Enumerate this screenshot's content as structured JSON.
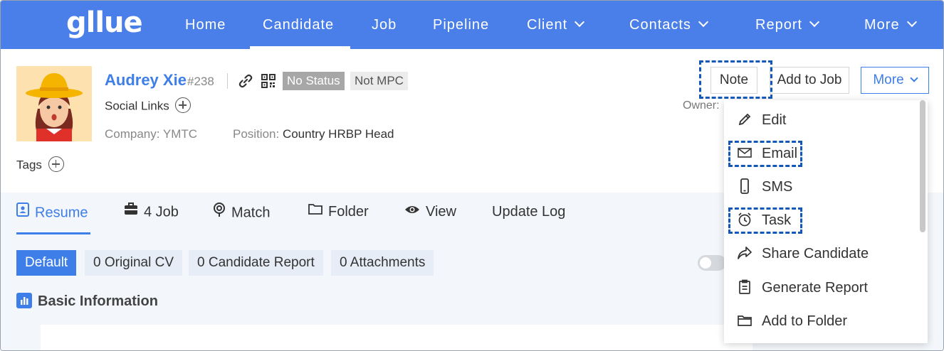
{
  "app": {
    "logo": "gllue"
  },
  "nav": {
    "items": [
      {
        "label": "Home"
      },
      {
        "label": "Candidate"
      },
      {
        "label": "Job"
      },
      {
        "label": "Pipeline"
      },
      {
        "label": "Client"
      },
      {
        "label": "Contacts"
      },
      {
        "label": "Report"
      },
      {
        "label": "More"
      }
    ],
    "active": "Candidate"
  },
  "candidate": {
    "name": "Audrey Xie",
    "id": "#238",
    "status_badge": "No Status",
    "mpc_badge": "Not MPC",
    "social_links_label": "Social Links",
    "company_label": "Company: YMTC",
    "position_label": "Position:",
    "position_value": "Country HRBP Head",
    "tags_label": "Tags",
    "owner_label": "Owner:"
  },
  "actions": {
    "note": "Note",
    "add_to_job": "Add to Job",
    "more": "More"
  },
  "dropdown": {
    "items": [
      {
        "label": "Edit",
        "icon": "pencil-icon"
      },
      {
        "label": "Email",
        "icon": "envelope-icon"
      },
      {
        "label": "SMS",
        "icon": "phone-icon"
      },
      {
        "label": "Task",
        "icon": "alarm-clock-icon"
      },
      {
        "label": "Share Candidate",
        "icon": "share-arrow-icon"
      },
      {
        "label": "Generate Report",
        "icon": "clipboard-icon"
      },
      {
        "label": "Add to Folder",
        "icon": "folder-icon"
      }
    ]
  },
  "tabs": [
    {
      "label": "Resume",
      "icon": "resume-icon"
    },
    {
      "label": "4 Job",
      "icon": "briefcase-icon"
    },
    {
      "label": "Match",
      "icon": "location-pin-icon"
    },
    {
      "label": "Folder",
      "icon": "folder-icon"
    },
    {
      "label": "View",
      "icon": "eye-icon"
    },
    {
      "label": "Update Log"
    }
  ],
  "resume_pills": [
    {
      "label": "Default"
    },
    {
      "label": "0 Original CV"
    },
    {
      "label": "0 Candidate Report"
    },
    {
      "label": "0 Attachments"
    }
  ],
  "section": {
    "basic_info": "Basic Information"
  },
  "colors": {
    "primary": "#4a7ee8",
    "accent": "#3e7ee8",
    "highlight_dash": "#1358b8",
    "no_status_bg": "#a7a7a7"
  }
}
